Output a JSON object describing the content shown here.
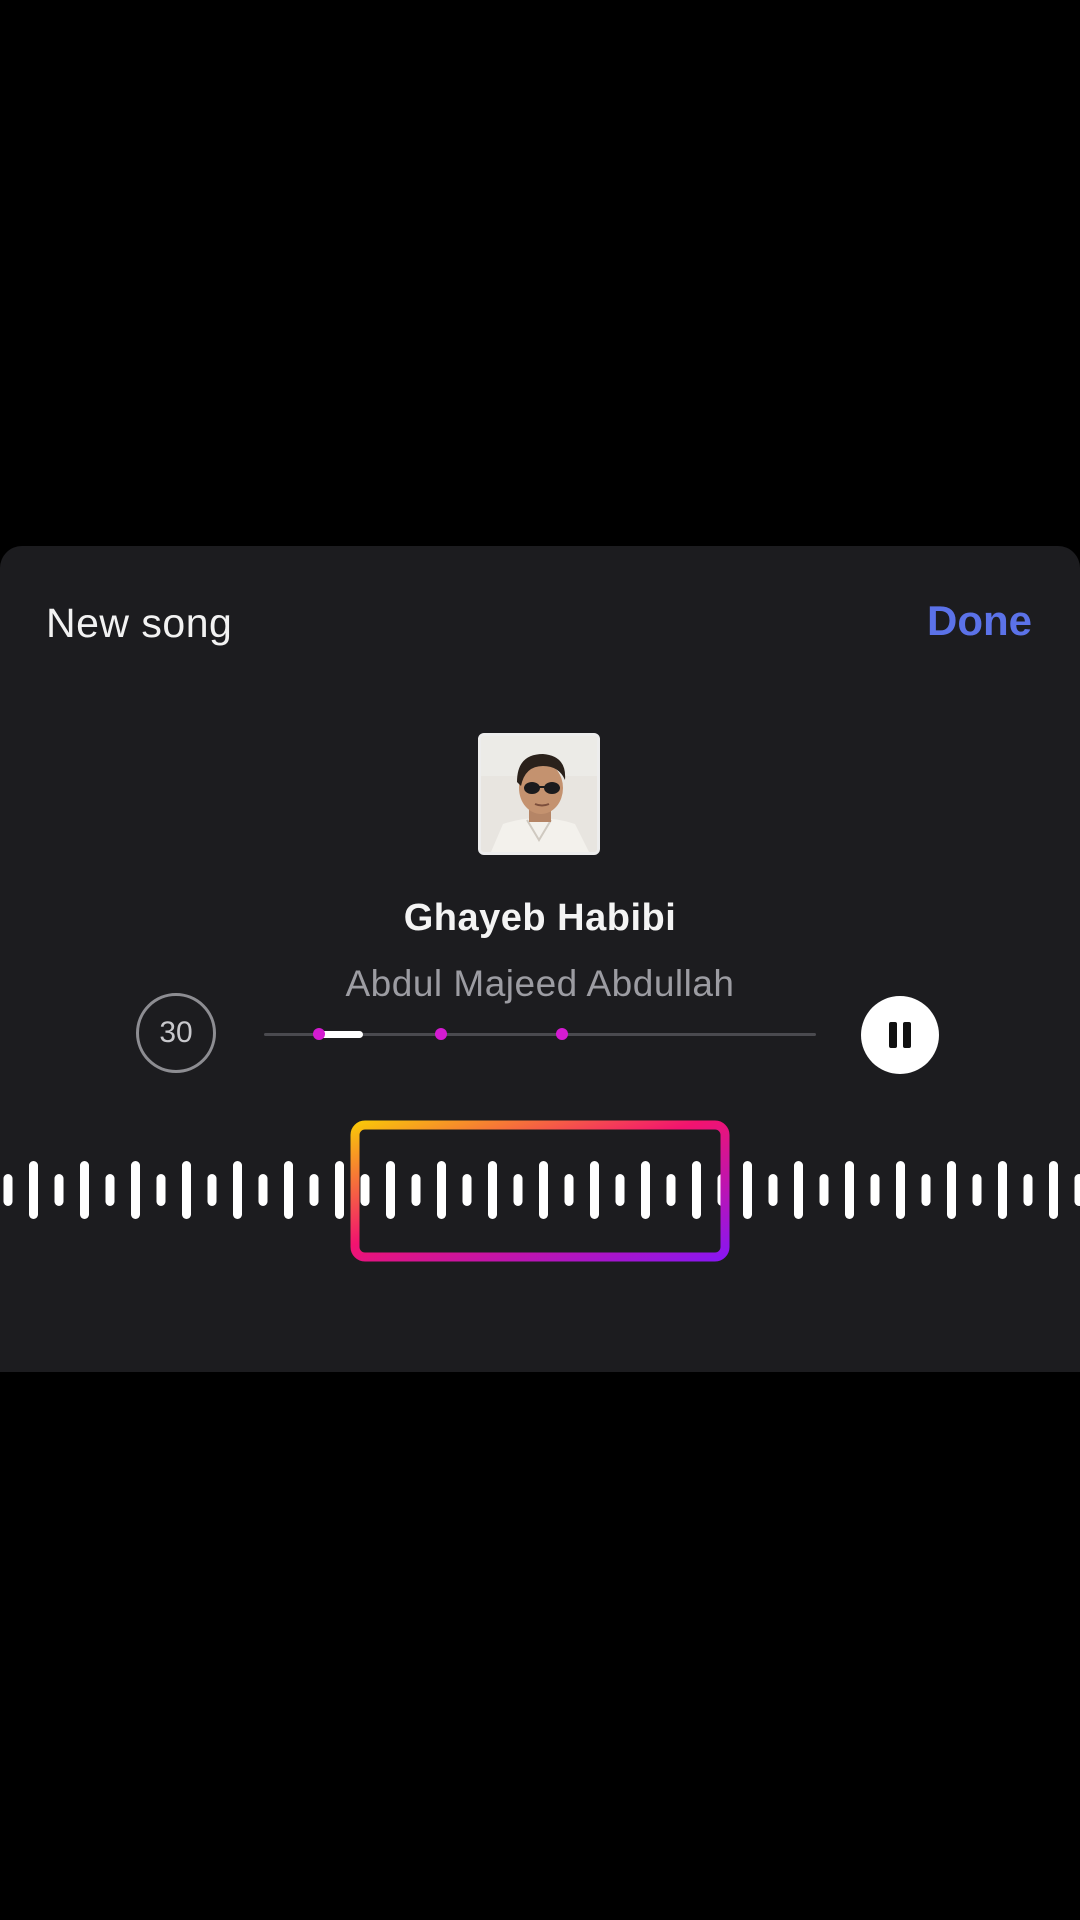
{
  "header": {
    "title": "New song",
    "done_label": "Done"
  },
  "song": {
    "title": "Ghayeb Habibi",
    "artist": "Abdul Majeed Abdullah"
  },
  "player": {
    "duration_label": "30",
    "progress_start_fraction": 0.1,
    "progress_fill_fraction": 0.08,
    "marker_fractions": [
      0.1,
      0.32,
      0.54
    ],
    "state": "playing",
    "pause_icon": "pause-icon"
  },
  "colors": {
    "accent_blue": "#5b72e8",
    "marker_magenta": "#d41bd1",
    "gradient_start": "#f9c40a",
    "gradient_mid": "#f2136f",
    "gradient_end": "#8a16f0"
  },
  "waveform": {
    "pattern": [
      "short",
      "tall"
    ]
  }
}
